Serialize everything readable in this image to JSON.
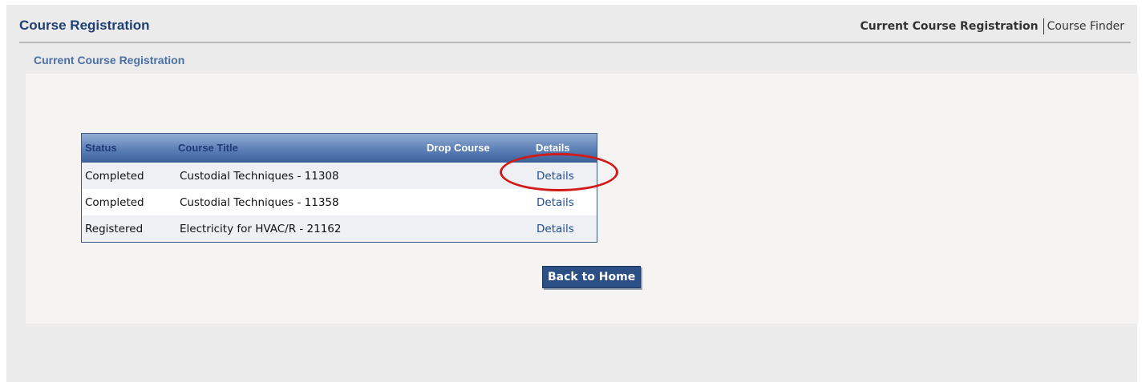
{
  "header": {
    "app_title": "Course Registration",
    "nav": {
      "current": "Current Course Registration",
      "link": "Course Finder"
    }
  },
  "section": {
    "title": "Current Course Registration"
  },
  "table": {
    "headers": {
      "status": "Status",
      "course_title": "Course Title",
      "drop_course": "Drop Course",
      "details": "Details"
    },
    "rows": [
      {
        "status": "Completed",
        "course_title": "Custodial Techniques - 11308",
        "details": "Details"
      },
      {
        "status": "Completed",
        "course_title": "Custodial Techniques - 11358",
        "details": "Details"
      },
      {
        "status": "Registered",
        "course_title": "Electricity for HVAC/R - 21162",
        "details": "Details"
      }
    ]
  },
  "actions": {
    "back_home": "Back to Home"
  },
  "colors": {
    "brand_blue": "#1e3f73",
    "header_gradient": "#5c7fb6",
    "highlight_red": "#d11a1a"
  }
}
